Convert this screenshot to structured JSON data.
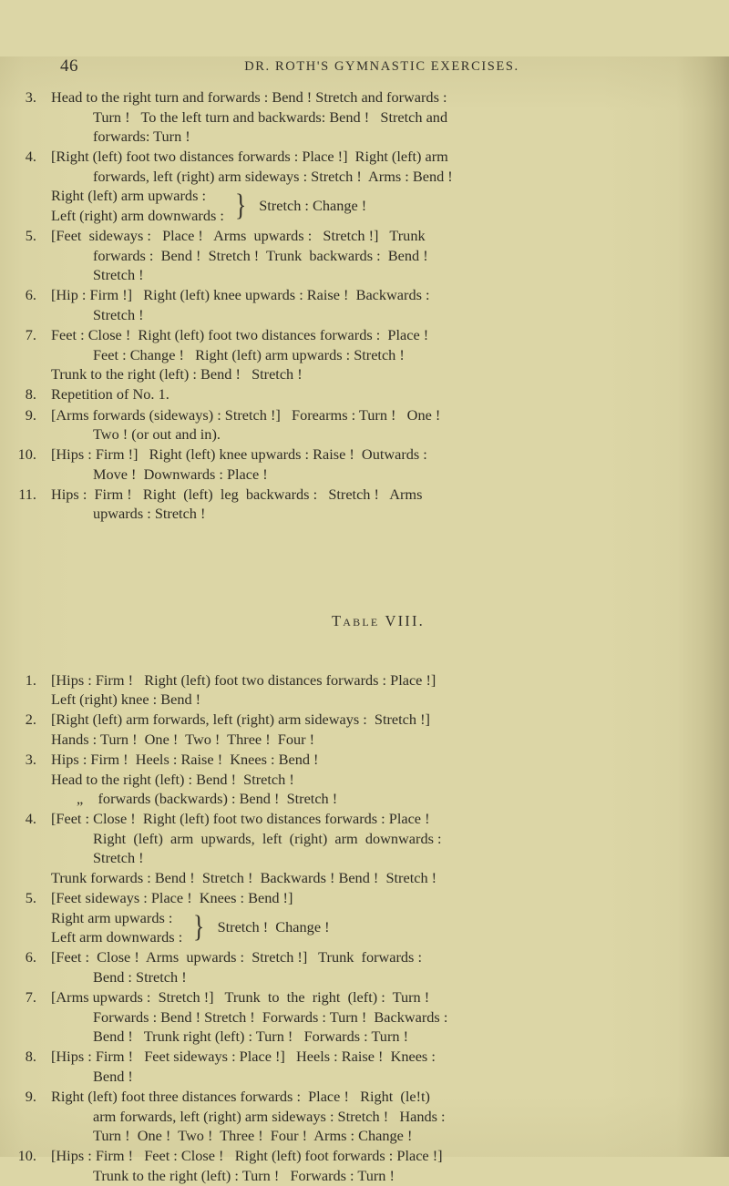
{
  "page": {
    "folio": "46",
    "running_title": "DR. ROTH'S GYMNASTIC EXERCISES."
  },
  "section_one": {
    "items": [
      {
        "num": "3.",
        "lines": [
          "Head to the right turn and forwards : Bend ! Stretch and forwards :",
          "Turn !   To the left turn and backwards: Bend !   Stretch and",
          "forwards: Turn !"
        ]
      },
      {
        "num": "4.",
        "lines": [
          "[Right (left) foot two distances forwards : Place !]  Right (left) arm",
          "forwards, left (right) arm sideways : Stretch !  Arms : Bend !"
        ],
        "brace": {
          "rows": [
            "Right (left) arm upwards :",
            "Left (right) arm downwards :"
          ],
          "after": "Stretch : Change !"
        }
      },
      {
        "num": "5.",
        "lines": [
          "[Feet  sideways :   Place !   Arms  upwards :   Stretch !]   Trunk",
          "forwards :  Bend !  Stretch !  Trunk  backwards :  Bend !",
          "Stretch !"
        ]
      },
      {
        "num": "6.",
        "lines": [
          "[Hip : Firm !]   Right (left) knee upwards : Raise !  Backwards :",
          "Stretch !"
        ]
      },
      {
        "num": "7.",
        "lines": [
          "Feet : Close !  Right (left) foot two distances forwards :  Place !",
          "Feet : Change !   Right (left) arm upwards : Stretch !"
        ],
        "flush_lines": [
          "Trunk to the right (left) : Bend !   Stretch !"
        ]
      },
      {
        "num": "8.",
        "lines": [
          "Repetition of No. 1."
        ]
      },
      {
        "num": "9.",
        "lines": [
          "[Arms forwards (sideways) : Stretch !]   Forearms : Turn !   One !",
          "Two ! (or out and in)."
        ]
      },
      {
        "num": "10.",
        "lines": [
          "[Hips : Firm !]   Right (left) knee upwards : Raise !  Outwards :",
          "Move !  Downwards : Place !"
        ]
      },
      {
        "num": "11.",
        "lines": [
          "Hips :  Firm !   Right  (left)  leg  backwards :   Stretch !   Arms",
          "upwards : Stretch !"
        ]
      }
    ]
  },
  "table_caption": "Table VIII.",
  "section_two": {
    "items": [
      {
        "num": "1.",
        "lines": [
          "[Hips : Firm !   Right (left) foot two distances forwards : Place !]"
        ],
        "flush_lines": [
          "Left (right) knee : Bend !"
        ]
      },
      {
        "num": "2.",
        "lines": [
          "[Right (left) arm forwards, left (right) arm sideways :  Stretch !]"
        ],
        "flush_lines": [
          "Hands : Turn !  One !  Two !  Three !  Four !"
        ]
      },
      {
        "num": "3.",
        "lines": [
          "Hips : Firm !  Heels : Raise !  Knees : Bend !"
        ],
        "flush_lines": [
          "Head to the right (left) : Bend !  Stretch !"
        ],
        "ditto_line": "„    forwards (backwards) : Bend !  Stretch !"
      },
      {
        "num": "4.",
        "lines": [
          "[Feet : Close !  Right (left) foot two distances forwards : Place !",
          "Right  (left)  arm  upwards,  left  (right)  arm  downwards :",
          "Stretch !"
        ],
        "flush_lines": [
          "Trunk forwards : Bend !  Stretch !  Backwards ! Bend !  Stretch !"
        ]
      },
      {
        "num": "5.",
        "lines": [
          "[Feet sideways : Place !  Knees : Bend !]"
        ],
        "brace": {
          "rows": [
            "Right arm upwards :",
            "Left arm downwards :"
          ],
          "after": "Stretch !  Change !"
        }
      },
      {
        "num": "6.",
        "lines": [
          "[Feet :  Close !  Arms  upwards :  Stretch !]   Trunk  forwards :",
          "Bend : Stretch !"
        ]
      },
      {
        "num": "7.",
        "lines": [
          "[Arms upwards :  Stretch !]   Trunk  to  the  right  (left) :  Turn !",
          "Forwards : Bend ! Stretch !  Forwards : Turn !  Backwards :",
          "Bend !   Trunk right (left) : Turn !   Forwards : Turn !"
        ]
      },
      {
        "num": "8.",
        "lines": [
          "[Hips : Firm !   Feet sideways : Place !]   Heels : Raise !  Knees :",
          "Bend !"
        ]
      },
      {
        "num": "9.",
        "lines": [
          "Right (left) foot three distances forwards :  Place !   Right  (le!t)",
          "arm forwards, left (right) arm sideways : Stretch !   Hands :",
          "Turn !  One !  Two !  Three !  Four !  Arms : Change !"
        ]
      },
      {
        "num": "10.",
        "lines": [
          "[Hips : Firm !   Feet : Close !   Right (left) foot forwards : Place !]",
          "Trunk to the right (left) : Turn !   Forwards : Turn !"
        ]
      }
    ]
  }
}
